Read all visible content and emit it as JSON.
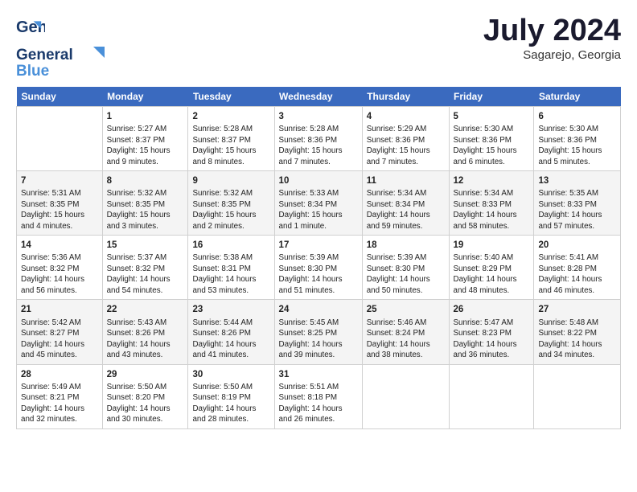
{
  "header": {
    "logo_line1": "General",
    "logo_line2": "Blue",
    "month": "July 2024",
    "location": "Sagarejo, Georgia"
  },
  "days_of_week": [
    "Sunday",
    "Monday",
    "Tuesday",
    "Wednesday",
    "Thursday",
    "Friday",
    "Saturday"
  ],
  "weeks": [
    [
      {
        "day": "",
        "info": ""
      },
      {
        "day": "1",
        "info": "Sunrise: 5:27 AM\nSunset: 8:37 PM\nDaylight: 15 hours\nand 9 minutes."
      },
      {
        "day": "2",
        "info": "Sunrise: 5:28 AM\nSunset: 8:37 PM\nDaylight: 15 hours\nand 8 minutes."
      },
      {
        "day": "3",
        "info": "Sunrise: 5:28 AM\nSunset: 8:36 PM\nDaylight: 15 hours\nand 7 minutes."
      },
      {
        "day": "4",
        "info": "Sunrise: 5:29 AM\nSunset: 8:36 PM\nDaylight: 15 hours\nand 7 minutes."
      },
      {
        "day": "5",
        "info": "Sunrise: 5:30 AM\nSunset: 8:36 PM\nDaylight: 15 hours\nand 6 minutes."
      },
      {
        "day": "6",
        "info": "Sunrise: 5:30 AM\nSunset: 8:36 PM\nDaylight: 15 hours\nand 5 minutes."
      }
    ],
    [
      {
        "day": "7",
        "info": "Sunrise: 5:31 AM\nSunset: 8:35 PM\nDaylight: 15 hours\nand 4 minutes."
      },
      {
        "day": "8",
        "info": "Sunrise: 5:32 AM\nSunset: 8:35 PM\nDaylight: 15 hours\nand 3 minutes."
      },
      {
        "day": "9",
        "info": "Sunrise: 5:32 AM\nSunset: 8:35 PM\nDaylight: 15 hours\nand 2 minutes."
      },
      {
        "day": "10",
        "info": "Sunrise: 5:33 AM\nSunset: 8:34 PM\nDaylight: 15 hours\nand 1 minute."
      },
      {
        "day": "11",
        "info": "Sunrise: 5:34 AM\nSunset: 8:34 PM\nDaylight: 14 hours\nand 59 minutes."
      },
      {
        "day": "12",
        "info": "Sunrise: 5:34 AM\nSunset: 8:33 PM\nDaylight: 14 hours\nand 58 minutes."
      },
      {
        "day": "13",
        "info": "Sunrise: 5:35 AM\nSunset: 8:33 PM\nDaylight: 14 hours\nand 57 minutes."
      }
    ],
    [
      {
        "day": "14",
        "info": "Sunrise: 5:36 AM\nSunset: 8:32 PM\nDaylight: 14 hours\nand 56 minutes."
      },
      {
        "day": "15",
        "info": "Sunrise: 5:37 AM\nSunset: 8:32 PM\nDaylight: 14 hours\nand 54 minutes."
      },
      {
        "day": "16",
        "info": "Sunrise: 5:38 AM\nSunset: 8:31 PM\nDaylight: 14 hours\nand 53 minutes."
      },
      {
        "day": "17",
        "info": "Sunrise: 5:39 AM\nSunset: 8:30 PM\nDaylight: 14 hours\nand 51 minutes."
      },
      {
        "day": "18",
        "info": "Sunrise: 5:39 AM\nSunset: 8:30 PM\nDaylight: 14 hours\nand 50 minutes."
      },
      {
        "day": "19",
        "info": "Sunrise: 5:40 AM\nSunset: 8:29 PM\nDaylight: 14 hours\nand 48 minutes."
      },
      {
        "day": "20",
        "info": "Sunrise: 5:41 AM\nSunset: 8:28 PM\nDaylight: 14 hours\nand 46 minutes."
      }
    ],
    [
      {
        "day": "21",
        "info": "Sunrise: 5:42 AM\nSunset: 8:27 PM\nDaylight: 14 hours\nand 45 minutes."
      },
      {
        "day": "22",
        "info": "Sunrise: 5:43 AM\nSunset: 8:26 PM\nDaylight: 14 hours\nand 43 minutes."
      },
      {
        "day": "23",
        "info": "Sunrise: 5:44 AM\nSunset: 8:26 PM\nDaylight: 14 hours\nand 41 minutes."
      },
      {
        "day": "24",
        "info": "Sunrise: 5:45 AM\nSunset: 8:25 PM\nDaylight: 14 hours\nand 39 minutes."
      },
      {
        "day": "25",
        "info": "Sunrise: 5:46 AM\nSunset: 8:24 PM\nDaylight: 14 hours\nand 38 minutes."
      },
      {
        "day": "26",
        "info": "Sunrise: 5:47 AM\nSunset: 8:23 PM\nDaylight: 14 hours\nand 36 minutes."
      },
      {
        "day": "27",
        "info": "Sunrise: 5:48 AM\nSunset: 8:22 PM\nDaylight: 14 hours\nand 34 minutes."
      }
    ],
    [
      {
        "day": "28",
        "info": "Sunrise: 5:49 AM\nSunset: 8:21 PM\nDaylight: 14 hours\nand 32 minutes."
      },
      {
        "day": "29",
        "info": "Sunrise: 5:50 AM\nSunset: 8:20 PM\nDaylight: 14 hours\nand 30 minutes."
      },
      {
        "day": "30",
        "info": "Sunrise: 5:50 AM\nSunset: 8:19 PM\nDaylight: 14 hours\nand 28 minutes."
      },
      {
        "day": "31",
        "info": "Sunrise: 5:51 AM\nSunset: 8:18 PM\nDaylight: 14 hours\nand 26 minutes."
      },
      {
        "day": "",
        "info": ""
      },
      {
        "day": "",
        "info": ""
      },
      {
        "day": "",
        "info": ""
      }
    ]
  ]
}
